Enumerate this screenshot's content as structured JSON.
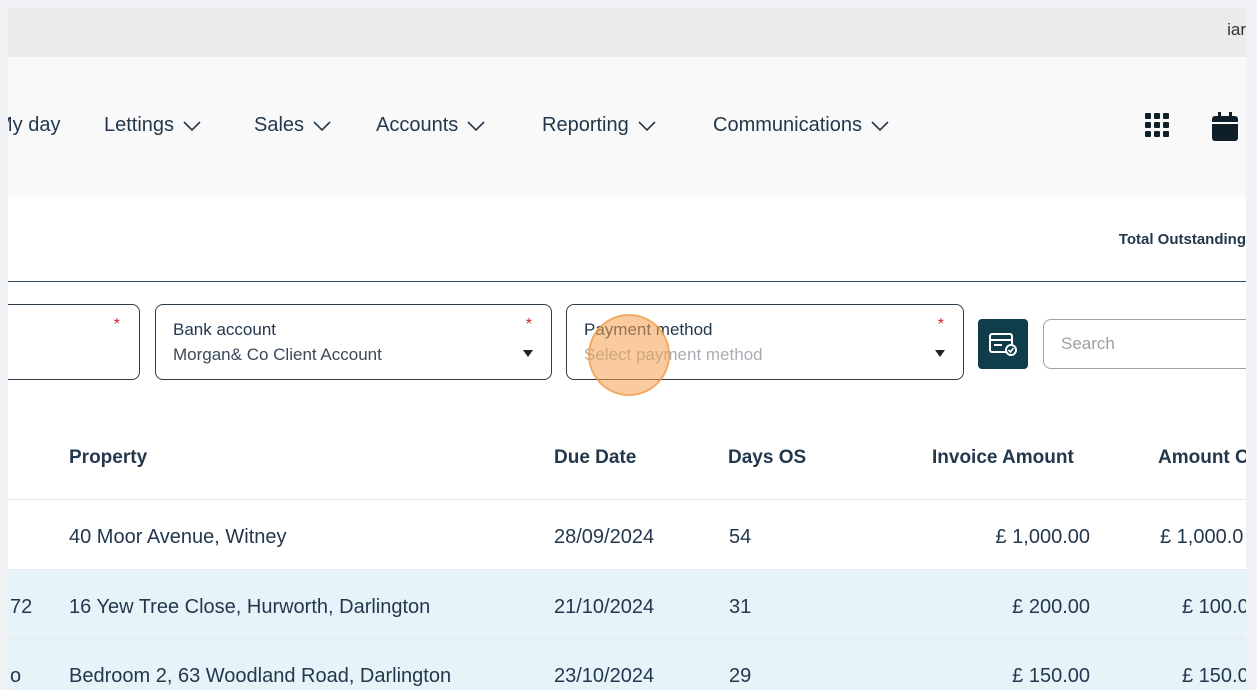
{
  "topbar": {
    "user_partial": "iar"
  },
  "nav": {
    "items": [
      {
        "label": "My day",
        "has_chevron": false
      },
      {
        "label": "Lettings",
        "has_chevron": true
      },
      {
        "label": "Sales",
        "has_chevron": true
      },
      {
        "label": "Accounts",
        "has_chevron": true
      },
      {
        "label": "Reporting",
        "has_chevron": true
      },
      {
        "label": "Communications",
        "has_chevron": true
      }
    ],
    "icons": [
      "apps-grid-icon",
      "calendar-icon"
    ]
  },
  "totals": {
    "label": "Total Outstanding"
  },
  "filters": {
    "bank_account": {
      "label": "Bank account",
      "value": "Morgan& Co Client Account",
      "required_mark": "*"
    },
    "payment_method": {
      "label": "Payment method",
      "placeholder": "Select payment method",
      "required_mark": "*"
    },
    "first_required_mark": "*"
  },
  "search": {
    "placeholder": "Search"
  },
  "table": {
    "headers": {
      "property": "Property",
      "due_date": "Due Date",
      "days_os": "Days OS",
      "invoice_amount": "Invoice Amount",
      "amount_outstanding": "Amount O"
    },
    "rows": [
      {
        "ref": "",
        "property": "40 Moor Avenue, Witney",
        "due_date": "28/09/2024",
        "days_os": "54",
        "invoice_amount": "£ 1,000.00",
        "amount_outstanding": "£ 1,000.0",
        "selected": false
      },
      {
        "ref": "72",
        "property": "16 Yew Tree Close, Hurworth, Darlington",
        "due_date": "21/10/2024",
        "days_os": "31",
        "invoice_amount": "£ 200.00",
        "amount_outstanding": "£ 100.0",
        "selected": true
      },
      {
        "ref": "o",
        "property": "Bedroom 2, 63 Woodland Road, Darlington",
        "due_date": "23/10/2024",
        "days_os": "29",
        "invoice_amount": "£ 150.00",
        "amount_outstanding": "£ 150.0",
        "selected": true
      }
    ]
  },
  "colors": {
    "accent": "#0f3d4a",
    "required": "#d0232c",
    "selected_row": "#e6f4fa",
    "text": "#23384d"
  }
}
